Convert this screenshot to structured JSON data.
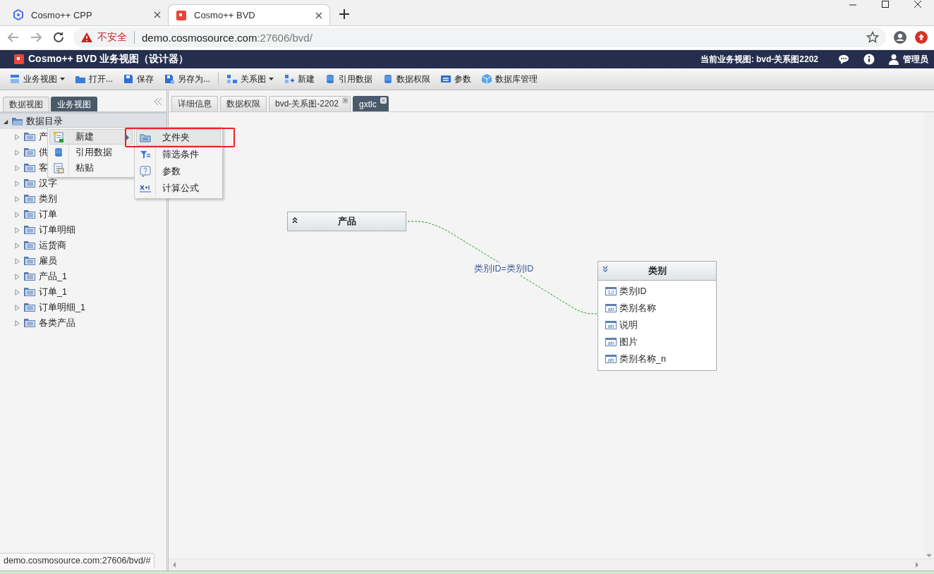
{
  "browser": {
    "tabs": [
      {
        "title": "Cosmo++ CPP",
        "selected": false
      },
      {
        "title": "Cosmo++ BVD",
        "selected": true
      }
    ],
    "security_label": "不安全",
    "url_host": "demo.cosmosource.com",
    "url_path": ":27606/bvd/"
  },
  "header": {
    "title": "Cosmo++ BVD 业务视图（设计器）",
    "current_view": "当前业务视图: bvd-关系图2202",
    "user": "管理员"
  },
  "toolbar": [
    {
      "label": "业务视图",
      "dropdown": true
    },
    {
      "label": "打开...",
      "dropdown": false
    },
    {
      "label": "保存",
      "dropdown": false
    },
    {
      "label": "另存为...",
      "dropdown": false
    },
    {
      "label": "关系图",
      "dropdown": true
    },
    {
      "label": "新建",
      "dropdown": false
    },
    {
      "label": "引用数据",
      "dropdown": false
    },
    {
      "label": "数据权限",
      "dropdown": false
    },
    {
      "label": "参数",
      "dropdown": false
    },
    {
      "label": "数据库管理",
      "dropdown": false
    }
  ],
  "sidebar": {
    "tabs": [
      {
        "label": "数据视图",
        "selected": false
      },
      {
        "label": "业务视图",
        "selected": true
      }
    ],
    "tree": {
      "label": "数据目录",
      "expanded": true,
      "children": [
        {
          "label": "产",
          "expanded": false
        },
        {
          "label": "供",
          "expanded": false
        },
        {
          "label": "客",
          "expanded": false
        },
        {
          "label": "汉字",
          "expanded": false
        },
        {
          "label": "类别",
          "expanded": false
        },
        {
          "label": "订单",
          "expanded": false
        },
        {
          "label": "订单明细",
          "expanded": false
        },
        {
          "label": "运货商",
          "expanded": false
        },
        {
          "label": "雇员",
          "expanded": false
        },
        {
          "label": "产品_1",
          "expanded": false
        },
        {
          "label": "订单_1",
          "expanded": false
        },
        {
          "label": "订单明细_1",
          "expanded": false
        },
        {
          "label": "各类产品",
          "expanded": false
        }
      ]
    }
  },
  "context_menu": {
    "items": [
      {
        "label": "新建",
        "submenu": true,
        "selected": true
      },
      {
        "label": "引用数据",
        "submenu": false,
        "selected": false
      },
      {
        "label": "粘贴",
        "submenu": false,
        "selected": false
      }
    ],
    "submenu": [
      {
        "label": "文件夹",
        "selected": true,
        "annotated": true
      },
      {
        "label": "筛选条件",
        "selected": false,
        "annotated": false
      },
      {
        "label": "参数",
        "selected": false,
        "annotated": false
      },
      {
        "label": "计算公式",
        "selected": false,
        "annotated": false
      }
    ]
  },
  "editor_tabs": [
    {
      "label": "详细信息",
      "selected": false,
      "closable": false
    },
    {
      "label": "数据权限",
      "selected": false,
      "closable": false
    },
    {
      "label": "bvd-关系图-2202",
      "selected": false,
      "closable": true
    },
    {
      "label": "gxtlc",
      "selected": true,
      "closable": true
    }
  ],
  "diagram": {
    "nodes": [
      {
        "title": "产品",
        "expanded": false
      },
      {
        "title": "类别",
        "expanded": true,
        "fields": [
          {
            "name": "类别ID",
            "type_label": "12"
          },
          {
            "name": "类别名称",
            "type_label": "ab"
          },
          {
            "name": "说明",
            "type_label": "ab"
          },
          {
            "name": "图片",
            "type_label": "ab"
          },
          {
            "name": "类别名称_n",
            "type_label": "ab"
          }
        ]
      }
    ],
    "link_label": "类别ID=类别ID"
  },
  "status_url": "demo.cosmosource.com:27606/bvd/#"
}
